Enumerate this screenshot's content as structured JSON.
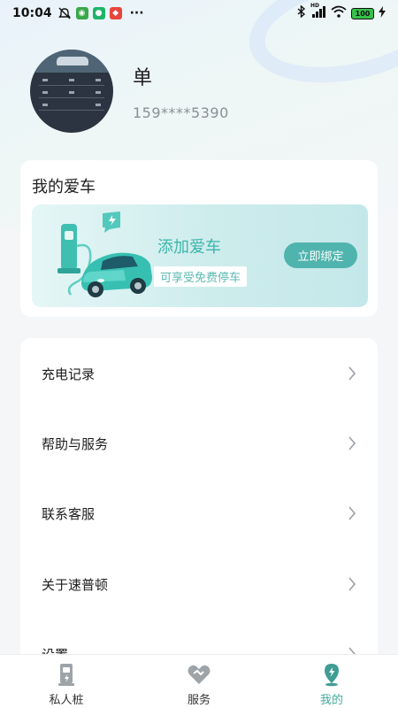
{
  "status_bar": {
    "time": "10:04",
    "more": "···",
    "battery": "100",
    "hd": "HD"
  },
  "profile": {
    "name": "单",
    "phone": "159****5390"
  },
  "my_car": {
    "title": "我的爱车",
    "banner_title": "添加爱车",
    "banner_subtitle": "可享受免费停车",
    "bind_button": "立即绑定"
  },
  "menu": [
    {
      "label": "充电记录"
    },
    {
      "label": "帮助与服务"
    },
    {
      "label": "联系客服"
    },
    {
      "label": "关于速普顿"
    },
    {
      "label": "设置"
    }
  ],
  "tabs": [
    {
      "label": "私人桩",
      "icon": "charger-pile-icon",
      "active": false
    },
    {
      "label": "服务",
      "icon": "heart-handshake-icon",
      "active": false
    },
    {
      "label": "我的",
      "icon": "user-pin-icon",
      "active": true
    }
  ],
  "colors": {
    "accent": "#45ab9e",
    "bind_button": "#4fb4ad",
    "banner_title": "#3cb6ab"
  }
}
